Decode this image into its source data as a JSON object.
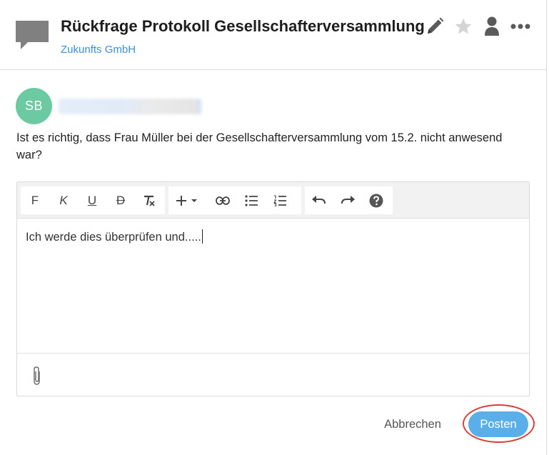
{
  "header": {
    "title": "Rückfrage Protokoll Gesellschafterversammlung",
    "subtitle": "Zukunfts GmbH",
    "icons": [
      "chat-icon",
      "pencil-icon",
      "star-icon",
      "person-icon",
      "more-icon"
    ]
  },
  "comment": {
    "avatar_initials": "SB",
    "avatar_color": "#6ccaa3",
    "text": "Ist es richtig, dass Frau Müller bei der Gesellschafterversammlung vom 15.2. nicht anwesend war?"
  },
  "toolbar": {
    "bold": "F",
    "italic": "K",
    "underline": "U",
    "strike": "D",
    "icons": [
      "clear-format-icon",
      "insert-icon",
      "link-icon",
      "bullet-list-icon",
      "numbered-list-icon",
      "undo-icon",
      "redo-icon",
      "help-icon"
    ]
  },
  "editor": {
    "value": "Ich werde dies überprüfen und....."
  },
  "actions": {
    "cancel_label": "Abbrechen",
    "post_label": "Posten"
  },
  "colors": {
    "accent": "#3b8fd6",
    "post_button": "#5aafe8",
    "highlight": "#d9403c"
  }
}
